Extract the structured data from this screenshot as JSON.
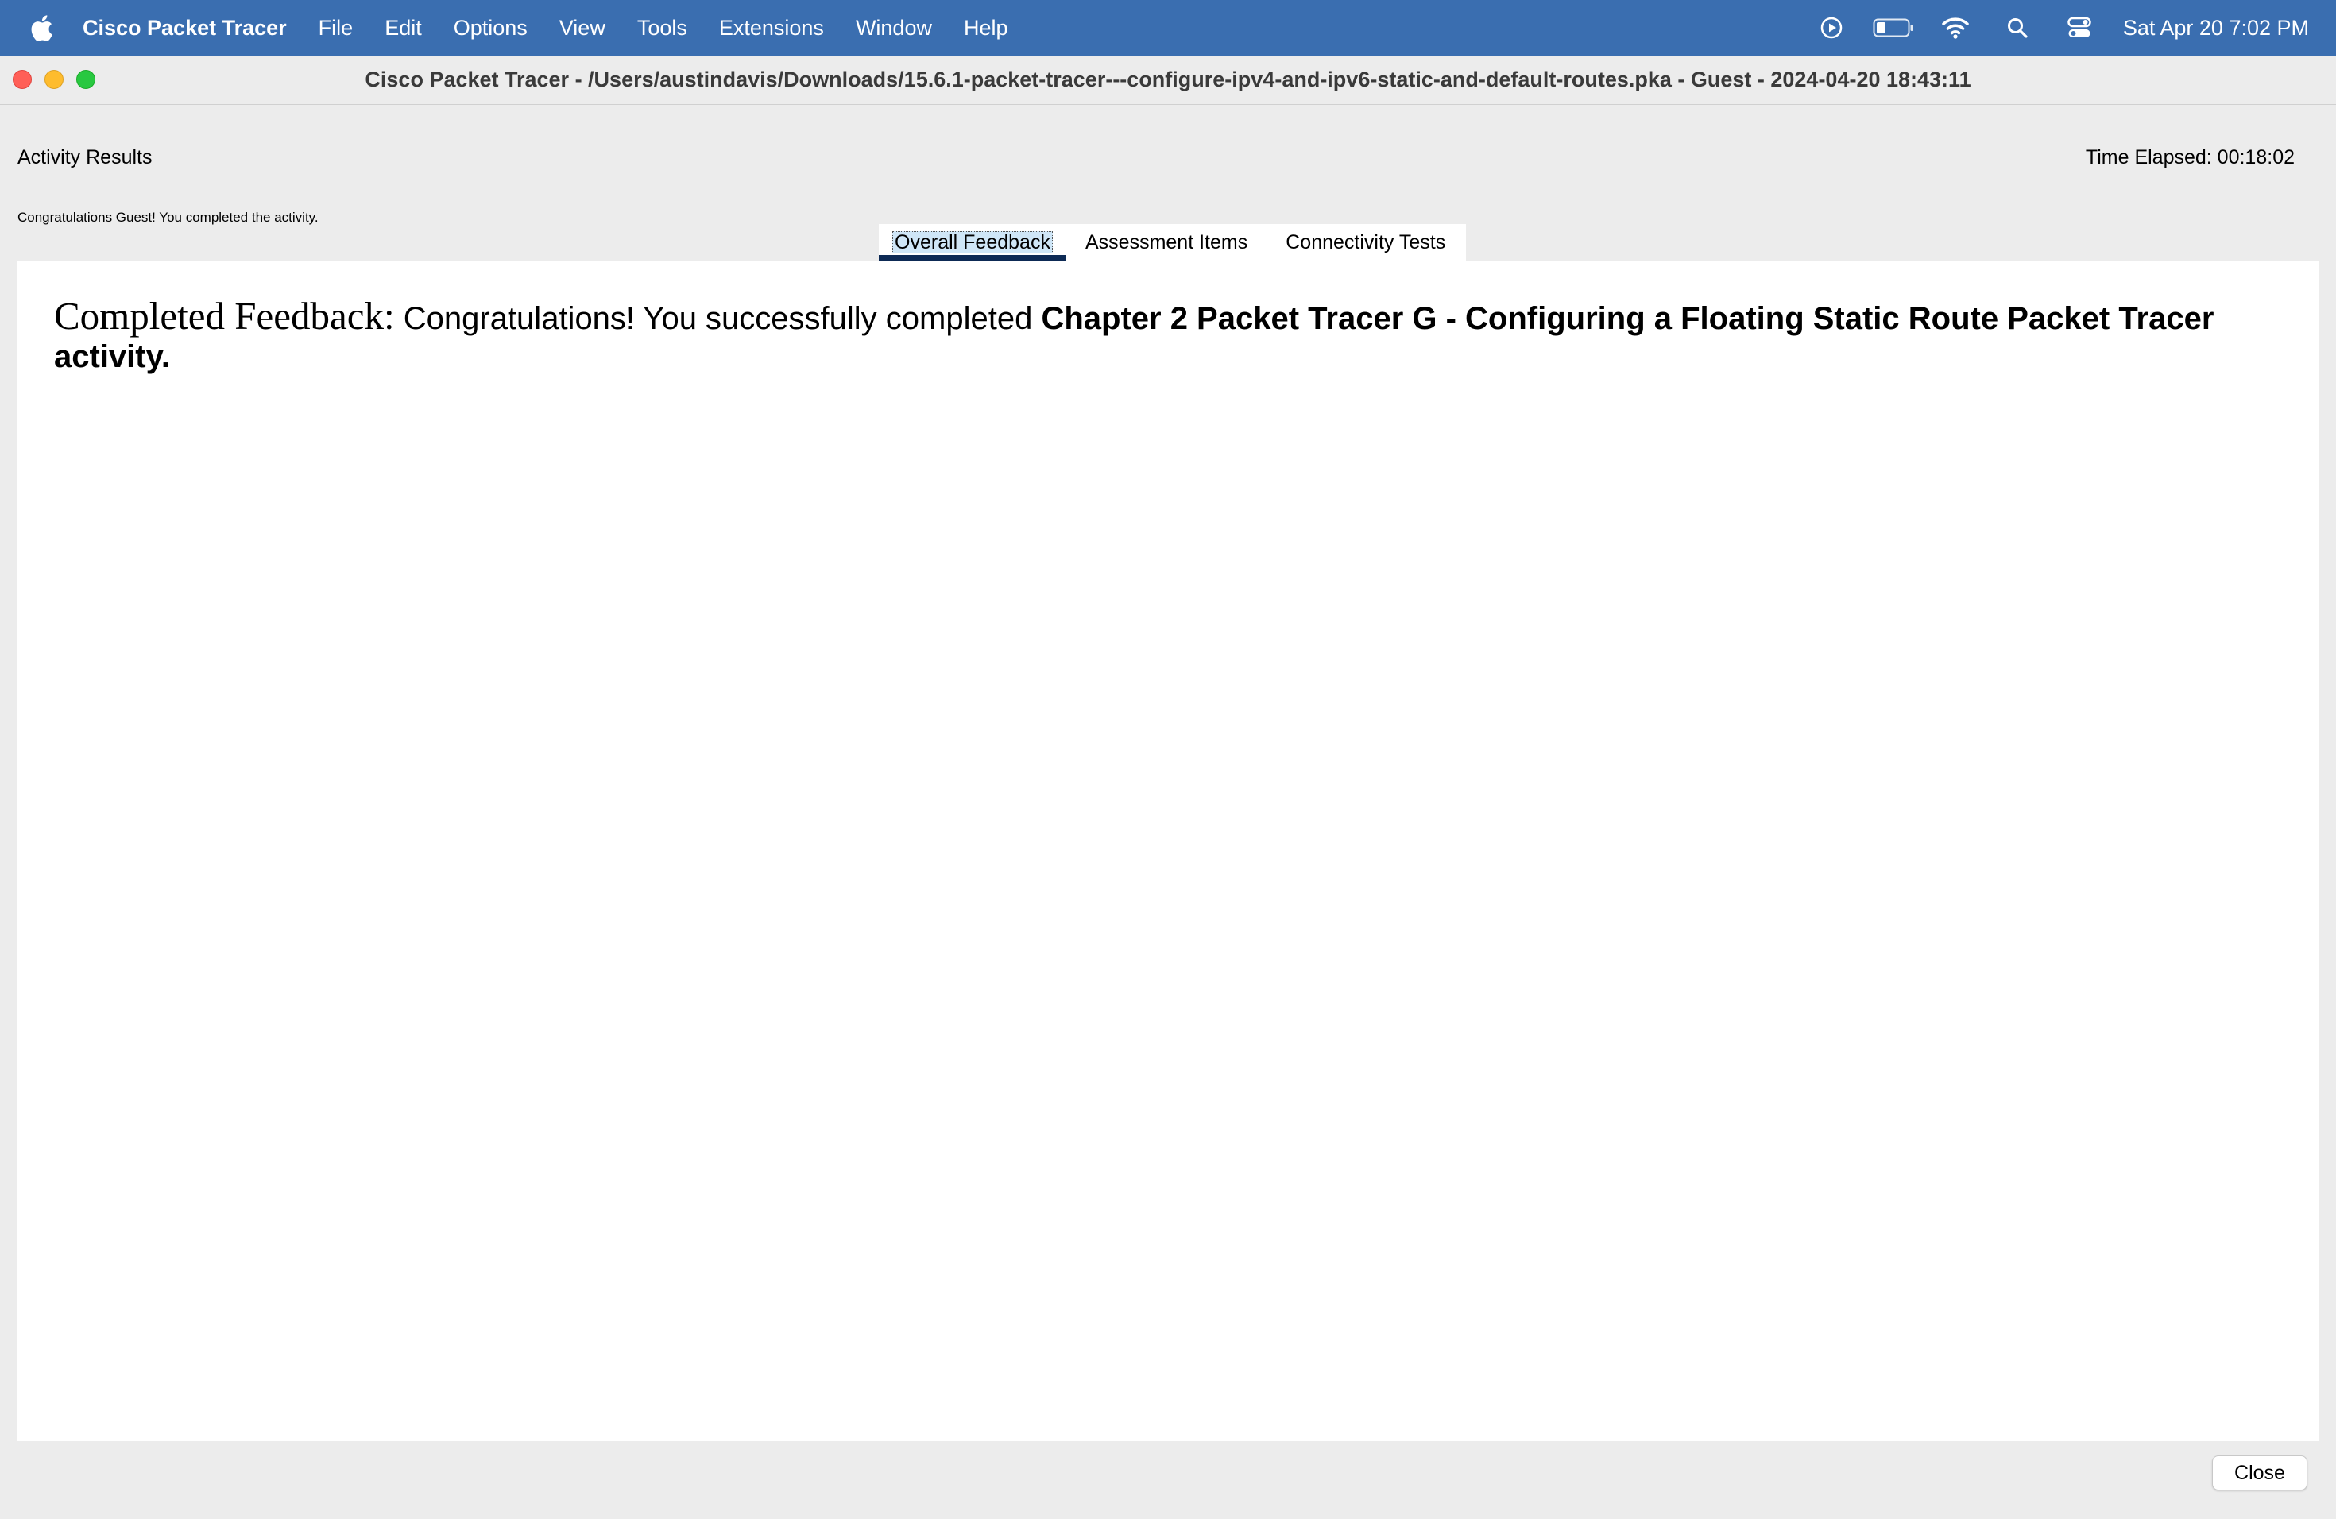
{
  "menubar": {
    "app_name": "Cisco Packet Tracer",
    "items": [
      "File",
      "Edit",
      "Options",
      "View",
      "Tools",
      "Extensions",
      "Window",
      "Help"
    ],
    "status_icons": [
      "play-circle-icon",
      "battery-icon",
      "wifi-icon",
      "search-icon",
      "control-center-icon"
    ],
    "clock": "Sat Apr 20  7:02 PM",
    "background_color": "#3a6eb0"
  },
  "window": {
    "title": "Cisco Packet Tracer - /Users/austindavis/Downloads/15.6.1-packet-tracer---configure-ipv4-and-ipv6-static-and-default-routes.pka - Guest - 2024-04-20 18:43:11"
  },
  "dialog": {
    "heading": "Activity Results",
    "time_elapsed": "Time Elapsed: 00:18:02",
    "congrats_message": "Congratulations Guest! You completed the activity.",
    "tabs": [
      {
        "label": "Overall Feedback",
        "active": true
      },
      {
        "label": "Assessment Items",
        "active": false
      },
      {
        "label": "Connectivity Tests",
        "active": false
      }
    ],
    "feedback": {
      "label": "Completed Feedback:",
      "body": " Congratulations! You successfully completed ",
      "activity_name": "Chapter 2 Packet Tracer G - Configuring a Floating Static Route Packet Tracer activity."
    },
    "close_label": "Close"
  }
}
